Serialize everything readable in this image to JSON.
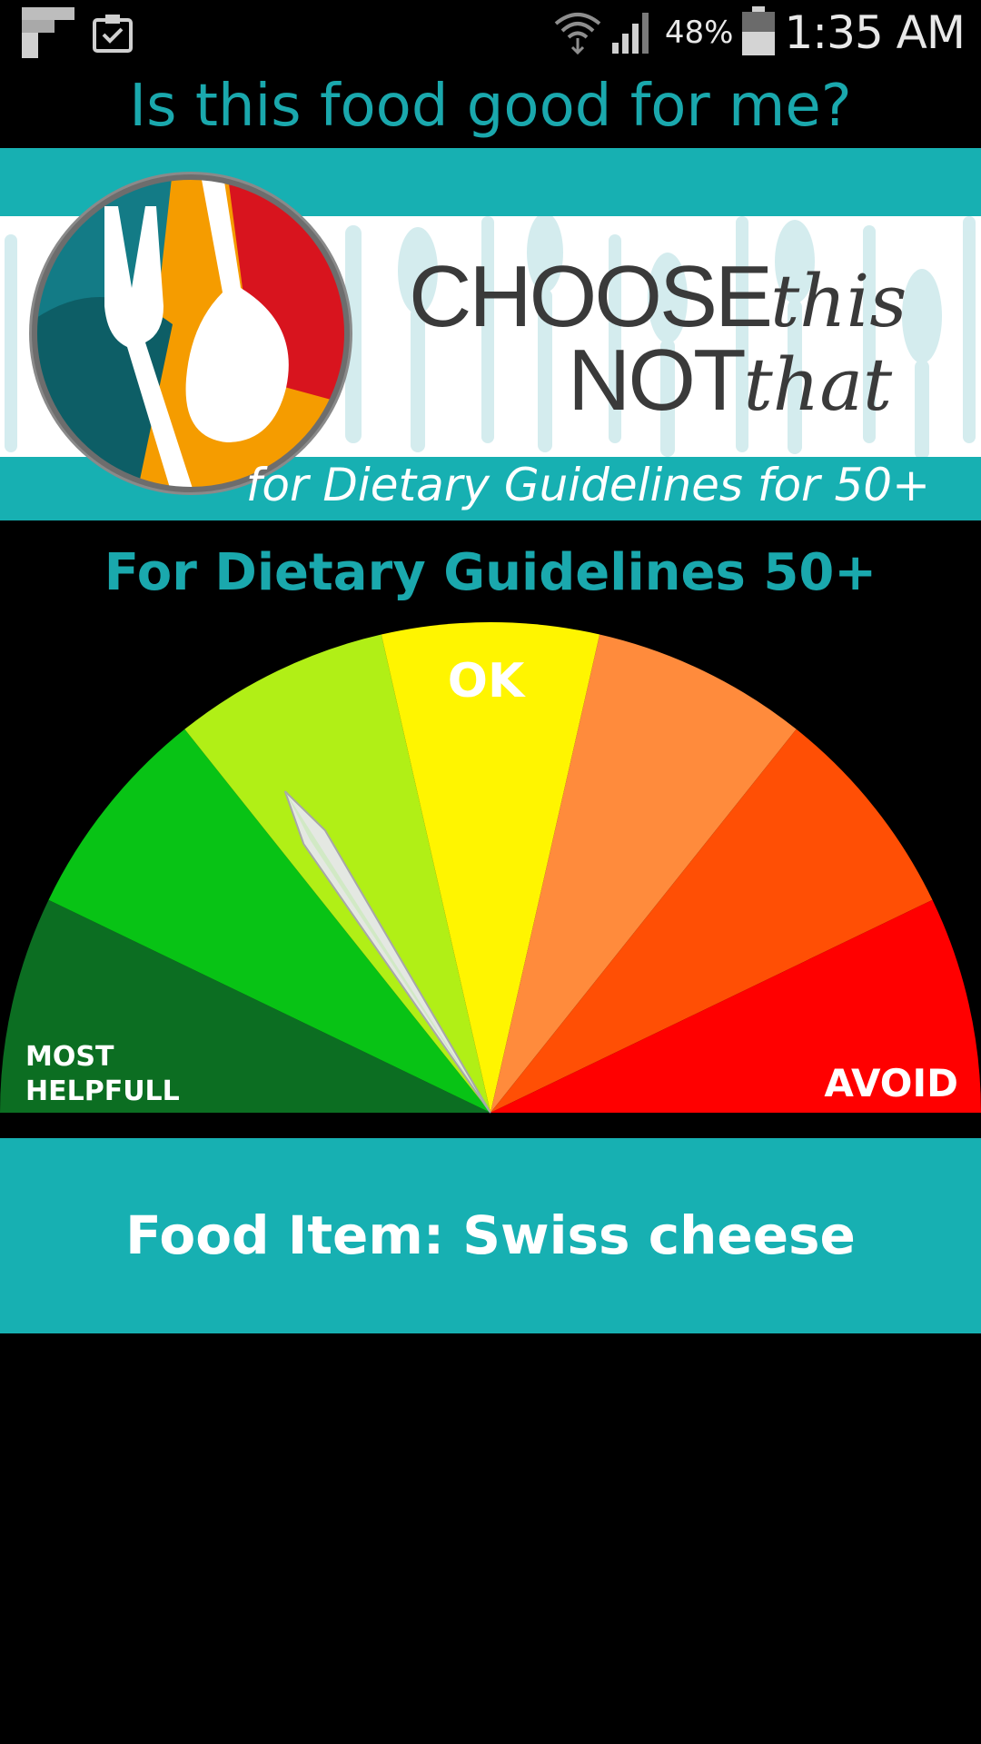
{
  "status_bar": {
    "battery_percent": "48%",
    "time": "1:35 AM"
  },
  "header": {
    "title": "Is this food good for me?"
  },
  "banner": {
    "line1_caps": "CHOOSE",
    "line1_script": "this",
    "line2_caps": "NOT",
    "line2_script": "that",
    "tagline": "for Dietary Guidelines for 50+"
  },
  "main": {
    "subtitle": "For Dietary Guidelines 50+",
    "gauge": {
      "ok_label": "OK",
      "left_label_line1": "MOST",
      "left_label_line2": "HELPFULL",
      "right_label": "AVOID",
      "segment_colors": [
        "#0c6e22",
        "#08c315",
        "#b1ef16",
        "#fff500",
        "#ff8b3c",
        "#ff4f05",
        "#ff0000"
      ],
      "needle_segment": 2
    },
    "food_item": "Food Item: Swiss cheese"
  }
}
